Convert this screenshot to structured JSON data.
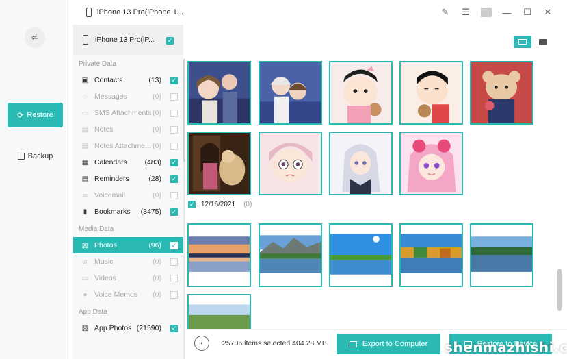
{
  "window": {
    "device_title": "iPhone 13 Pro(iPhone 1...",
    "controls": [
      "brush-icon",
      "menu-icon",
      "minimize-icon",
      "maximize-icon",
      "close-icon"
    ]
  },
  "rail": {
    "restore_label": "Restore",
    "backup_label": "Backup"
  },
  "panel": {
    "device_label": "iPhone 13 Pro(iP...",
    "sections": {
      "private": "Private Data",
      "media": "Media Data",
      "app": "App Data"
    },
    "private_items": [
      {
        "label": "Contacts",
        "count": "(13)",
        "checked": true,
        "disabled": false
      },
      {
        "label": "Messages",
        "count": "(0)",
        "checked": false,
        "disabled": true
      },
      {
        "label": "SMS Attachments",
        "count": "(0)",
        "checked": false,
        "disabled": true
      },
      {
        "label": "Notes",
        "count": "(0)",
        "checked": false,
        "disabled": true
      },
      {
        "label": "Notes Attachme...",
        "count": "(0)",
        "checked": false,
        "disabled": true
      },
      {
        "label": "Calendars",
        "count": "(483)",
        "checked": true,
        "disabled": false
      },
      {
        "label": "Reminders",
        "count": "(28)",
        "checked": true,
        "disabled": false
      },
      {
        "label": "Voicemail",
        "count": "(0)",
        "checked": false,
        "disabled": true
      },
      {
        "label": "Bookmarks",
        "count": "(3475)",
        "checked": true,
        "disabled": false
      }
    ],
    "media_items": [
      {
        "label": "Photos",
        "count": "(96)",
        "checked": true,
        "active": true
      },
      {
        "label": "Music",
        "count": "(0)",
        "checked": false,
        "disabled": true
      },
      {
        "label": "Videos",
        "count": "(0)",
        "checked": false,
        "disabled": true
      },
      {
        "label": "Voice Memos",
        "count": "(0)",
        "checked": false,
        "disabled": true
      }
    ],
    "app_items": [
      {
        "label": "App Photos",
        "count": "(21590)",
        "checked": true
      }
    ]
  },
  "content": {
    "date_group": {
      "date": "12/16/2021",
      "count": "(0)",
      "checked": true
    },
    "photos_row1": [
      "anime-photo",
      "anime-photo",
      "anime-photo",
      "anime-photo",
      "anime-photo"
    ],
    "photos_row2": [
      "photo",
      "anime-photo",
      "anime-photo",
      "anime-photo"
    ],
    "landscapes": [
      "landscape-photo",
      "landscape-photo",
      "landscape-photo",
      "landscape-photo",
      "landscape-photo",
      "landscape-photo"
    ]
  },
  "footer": {
    "selection_text": "25706 items selected 404.28 MB",
    "export_label": "Export to Computer",
    "restore_device_label": "Restore to Device"
  },
  "watermark": "shenmazhishi.co",
  "colors": {
    "accent": "#2bb9b4"
  }
}
